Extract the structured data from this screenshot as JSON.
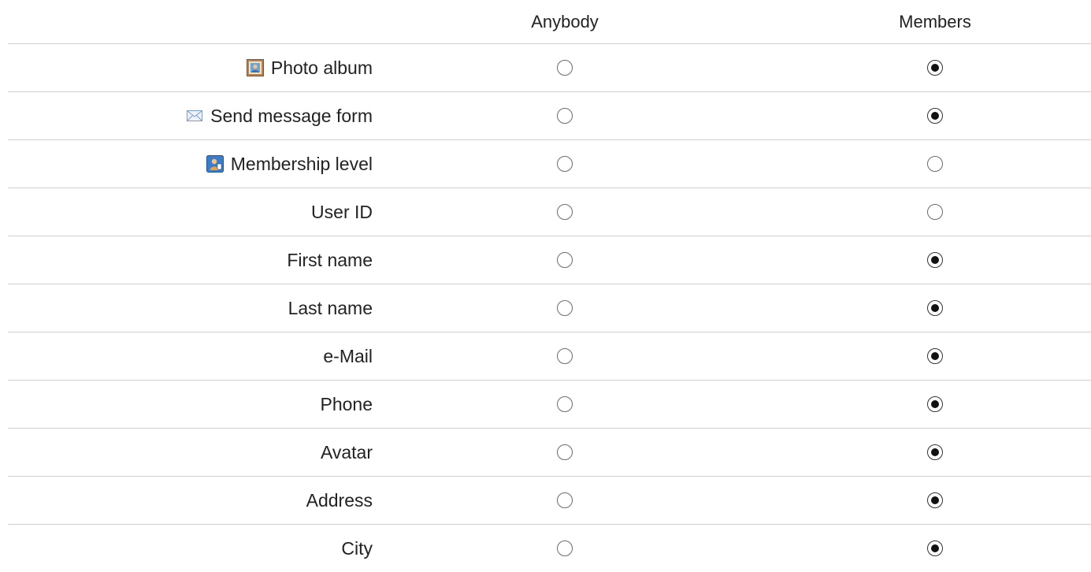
{
  "columns": {
    "anybody": "Anybody",
    "members": "Members"
  },
  "rows": [
    {
      "label": "Photo album",
      "icon": "photo-album-icon",
      "anybody": false,
      "members": true
    },
    {
      "label": "Send message form",
      "icon": "envelope-icon",
      "anybody": false,
      "members": true
    },
    {
      "label": "Membership level",
      "icon": "membership-level-icon",
      "anybody": false,
      "members": false
    },
    {
      "label": "User ID",
      "icon": null,
      "anybody": false,
      "members": false
    },
    {
      "label": "First name",
      "icon": null,
      "anybody": false,
      "members": true
    },
    {
      "label": "Last name",
      "icon": null,
      "anybody": false,
      "members": true
    },
    {
      "label": "e-Mail",
      "icon": null,
      "anybody": false,
      "members": true
    },
    {
      "label": "Phone",
      "icon": null,
      "anybody": false,
      "members": true
    },
    {
      "label": "Avatar",
      "icon": null,
      "anybody": false,
      "members": true
    },
    {
      "label": "Address",
      "icon": null,
      "anybody": false,
      "members": true
    },
    {
      "label": "City",
      "icon": null,
      "anybody": false,
      "members": true
    }
  ]
}
